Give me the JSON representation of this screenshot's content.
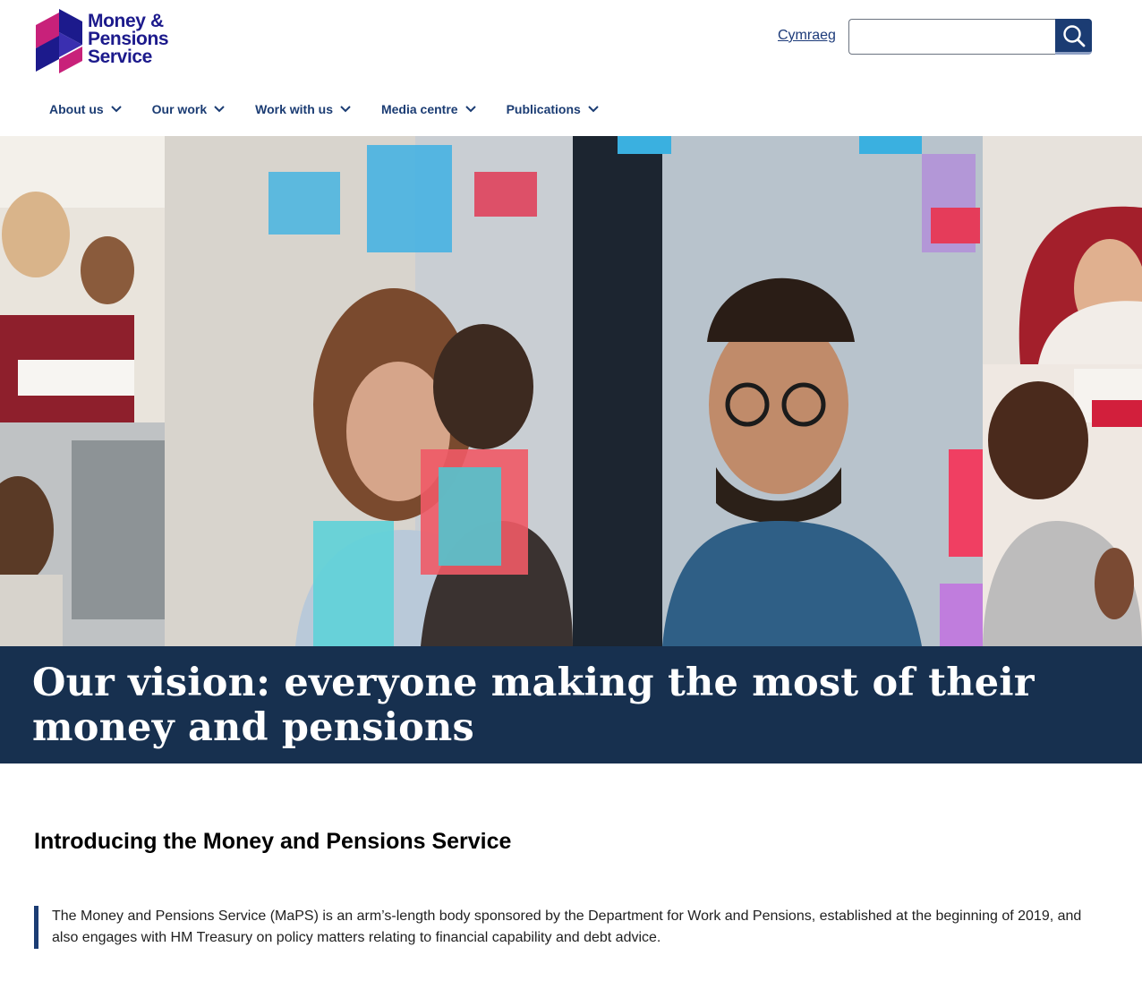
{
  "header": {
    "logo": {
      "line1": "Money &",
      "line2": "Pensions",
      "line3": "Service"
    },
    "language_link": "Cymraeg",
    "search": {
      "placeholder": "",
      "value": "",
      "button_icon": "search-icon"
    }
  },
  "nav": {
    "items": [
      {
        "label": "About us",
        "icon": "chevron-down-icon"
      },
      {
        "label": "Our work",
        "icon": "chevron-down-icon"
      },
      {
        "label": "Work with us",
        "icon": "chevron-down-icon"
      },
      {
        "label": "Media centre",
        "icon": "chevron-down-icon"
      },
      {
        "label": "Publications",
        "icon": "chevron-down-icon"
      }
    ]
  },
  "hero": {
    "image_description": "",
    "vision_title": "Our vision: everyone making the most of their money and pensions"
  },
  "main": {
    "heading": "Introducing the Money and Pensions Service",
    "intro_text": "The Money and Pensions Service (MaPS) is an arm’s-length body sponsored by the Department for Work and Pensions, established at the beginning of 2019, and also engages with HM Treasury on policy matters relating to financial capability and debt advice."
  },
  "colors": {
    "brand_navy": "#1b3c73",
    "brand_indigo": "#1c1a8c",
    "brand_magenta": "#c8217a",
    "banner": "#17304f"
  }
}
